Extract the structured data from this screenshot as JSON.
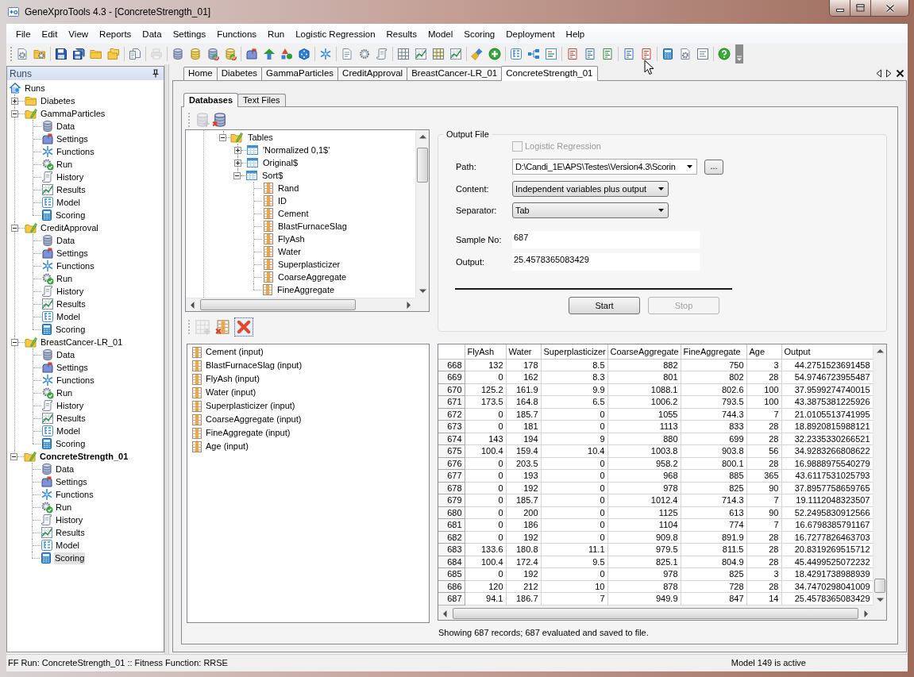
{
  "window": {
    "title": "GeneXproTools 4.3 - [ConcreteStrength_01]"
  },
  "menu": [
    "File",
    "Edit",
    "View",
    "Reports",
    "Data",
    "Settings",
    "Functions",
    "Run",
    "Logistic Regression",
    "Results",
    "Model",
    "Scoring",
    "Deployment",
    "Help"
  ],
  "toolbar": [
    [
      {
        "disabled": false
      },
      {
        "disabled": false
      }
    ],
    [
      {
        "disabled": false
      },
      {
        "disabled": false
      },
      {
        "disabled": false
      },
      {
        "disabled": false
      }
    ],
    [
      {
        "disabled": false
      }
    ],
    [
      {
        "disabled": true
      }
    ],
    [
      {
        "disabled": false
      },
      {
        "disabled": false
      },
      {
        "disabled": false
      },
      {
        "disabled": false
      }
    ],
    [
      {
        "disabled": false
      },
      {
        "disabled": false
      },
      {
        "disabled": false
      },
      {
        "disabled": false
      }
    ],
    [
      {
        "disabled": false
      }
    ],
    [
      {
        "disabled": false
      },
      {
        "disabled": false
      },
      {
        "disabled": false
      }
    ],
    [
      {
        "disabled": false
      },
      {
        "disabled": false
      },
      {
        "disabled": false
      },
      {
        "disabled": false
      }
    ],
    [
      {
        "disabled": false
      },
      {
        "disabled": false
      }
    ],
    [
      {
        "disabled": false
      },
      {
        "disabled": false
      },
      {
        "disabled": false
      }
    ],
    [
      {
        "disabled": false
      },
      {
        "disabled": false
      },
      {
        "disabled": false
      }
    ],
    [
      {
        "disabled": false
      },
      {
        "disabled": false
      }
    ],
    [
      {
        "disabled": false
      },
      {
        "disabled": false
      },
      {
        "disabled": false
      }
    ],
    [
      {
        "disabled": false
      }
    ]
  ],
  "sidebar": {
    "title": "Runs",
    "tree": [
      {
        "label": "Runs",
        "selected": false,
        "children": [
          {
            "label": "Diabetes",
            "expanded": false,
            "active": false,
            "selected": false
          },
          {
            "label": "GammaParticles",
            "expanded": true,
            "active": false,
            "selected": false,
            "children": [
              {
                "label": "Data",
                "kind": "data",
                "selected": false
              },
              {
                "label": "Settings",
                "kind": "settings",
                "selected": false
              },
              {
                "label": "Functions",
                "kind": "functions",
                "selected": false
              },
              {
                "label": "Run",
                "kind": "run",
                "selected": false
              },
              {
                "label": "History",
                "kind": "history",
                "selected": false
              },
              {
                "label": "Results",
                "kind": "results",
                "selected": false
              },
              {
                "label": "Model",
                "kind": "model",
                "selected": false
              },
              {
                "label": "Scoring",
                "kind": "scoring",
                "selected": false
              }
            ]
          },
          {
            "label": "CreditApproval",
            "expanded": true,
            "active": false,
            "selected": false,
            "children": [
              {
                "label": "Data",
                "kind": "data",
                "selected": false
              },
              {
                "label": "Settings",
                "kind": "settings",
                "selected": false
              },
              {
                "label": "Functions",
                "kind": "functions",
                "selected": false
              },
              {
                "label": "Run",
                "kind": "run",
                "selected": false
              },
              {
                "label": "History",
                "kind": "history",
                "selected": false
              },
              {
                "label": "Results",
                "kind": "results",
                "selected": false
              },
              {
                "label": "Model",
                "kind": "model",
                "selected": false
              },
              {
                "label": "Scoring",
                "kind": "scoring",
                "selected": false
              }
            ]
          },
          {
            "label": "BreastCancer-LR_01",
            "expanded": true,
            "active": false,
            "selected": false,
            "children": [
              {
                "label": "Data",
                "kind": "data",
                "selected": false
              },
              {
                "label": "Settings",
                "kind": "settings",
                "selected": false
              },
              {
                "label": "Functions",
                "kind": "functions",
                "selected": false
              },
              {
                "label": "Run",
                "kind": "run",
                "selected": false
              },
              {
                "label": "History",
                "kind": "history",
                "selected": false
              },
              {
                "label": "Results",
                "kind": "results",
                "selected": false
              },
              {
                "label": "Model",
                "kind": "model",
                "selected": false
              },
              {
                "label": "Scoring",
                "kind": "scoring",
                "selected": false
              }
            ]
          },
          {
            "label": "ConcreteStrength_01",
            "expanded": true,
            "active": true,
            "selected": false,
            "children": [
              {
                "label": "Data",
                "kind": "data",
                "selected": false
              },
              {
                "label": "Settings",
                "kind": "settings",
                "selected": false
              },
              {
                "label": "Functions",
                "kind": "functions",
                "selected": false
              },
              {
                "label": "Run",
                "kind": "run",
                "selected": false
              },
              {
                "label": "History",
                "kind": "history",
                "selected": false
              },
              {
                "label": "Results",
                "kind": "results",
                "selected": false
              },
              {
                "label": "Model",
                "kind": "model",
                "selected": false
              },
              {
                "label": "Scoring",
                "kind": "scoring",
                "selected": true
              }
            ]
          }
        ]
      }
    ]
  },
  "doc_tabs": [
    {
      "label": "Home",
      "selected": false
    },
    {
      "label": "Diabetes",
      "selected": false
    },
    {
      "label": "GammaParticles",
      "selected": false
    },
    {
      "label": "CreditApproval",
      "selected": false
    },
    {
      "label": "BreastCancer-LR_01",
      "selected": false
    },
    {
      "label": "ConcreteStrength_01",
      "selected": true
    }
  ],
  "database_tabs": [
    {
      "label": "Databases",
      "selected": true
    },
    {
      "label": "Text Files",
      "selected": false
    }
  ],
  "database_toolbar": [
    {
      "disabled": true
    },
    {
      "disabled": false
    }
  ],
  "table_tree": [
    {
      "label": "Tables",
      "expanded": true,
      "selected": false,
      "children": [
        {
          "label": "'Normalized 0,1$'",
          "expanded": false,
          "selected": false
        },
        {
          "label": "Original$",
          "expanded": false,
          "selected": false
        },
        {
          "label": "Sort$",
          "expanded": true,
          "selected": false,
          "children": [
            {
              "label": "Rand",
              "selected": false
            },
            {
              "label": "ID",
              "selected": false
            },
            {
              "label": "Cement",
              "selected": false
            },
            {
              "label": "BlastFurnaceSlag",
              "selected": false
            },
            {
              "label": "FlyAsh",
              "selected": false
            },
            {
              "label": "Water",
              "selected": false
            },
            {
              "label": "Superplasticizer",
              "selected": false
            },
            {
              "label": "CoarseAggregate",
              "selected": false
            },
            {
              "label": "FineAggregate",
              "selected": false
            }
          ]
        }
      ]
    }
  ],
  "field_toolbar": [
    {
      "disabled": true,
      "focused": false
    },
    {
      "disabled": false,
      "focused": false
    },
    {
      "disabled": false,
      "focused": true
    }
  ],
  "fields": [
    {
      "label": "Cement (input)",
      "selected": false
    },
    {
      "label": "BlastFurnaceSlag (input)",
      "selected": false
    },
    {
      "label": "FlyAsh (input)",
      "selected": false
    },
    {
      "label": "Water (input)",
      "selected": false
    },
    {
      "label": "Superplasticizer (input)",
      "selected": false
    },
    {
      "label": "CoarseAggregate (input)",
      "selected": false
    },
    {
      "label": "FineAggregate (input)",
      "selected": false
    },
    {
      "label": "Age (input)",
      "selected": false
    }
  ],
  "output_file": {
    "title": "Output File",
    "logistic_regression": {
      "label": "Logistic Regression",
      "checked": false,
      "disabled": true
    },
    "path": {
      "label": "Path:",
      "value": "D:\\Candi_1E\\APS\\Testes\\Version4.3\\Scorin"
    },
    "browse_button": {
      "label": "..."
    },
    "content": {
      "label": "Content:",
      "value": "Independent variables plus output"
    },
    "separator": {
      "label": "Separator:",
      "value": "Tab"
    },
    "sample_no": {
      "label": "Sample No:",
      "value": "687"
    },
    "output": {
      "label": "Output:",
      "value": "25.4578365083429"
    },
    "buttons": [
      {
        "label": "Start",
        "disabled": false
      },
      {
        "label": "Stop",
        "disabled": true
      }
    ]
  },
  "grid": {
    "columns": [
      "FlyAsh",
      "Water",
      "Superplasticizer",
      "CoarseAggregate",
      "FineAggregate",
      "Age",
      "Output"
    ],
    "rows": [
      {
        "header": "668",
        "cells": [
          "132",
          "178",
          "8.5",
          "882",
          "750",
          "3",
          "44.2751523691458"
        ]
      },
      {
        "header": "669",
        "cells": [
          "0",
          "162",
          "8.3",
          "801",
          "802",
          "28",
          "54.9746723955487"
        ]
      },
      {
        "header": "670",
        "cells": [
          "125.2",
          "161.9",
          "9.9",
          "1088.1",
          "802.6",
          "100",
          "37.9599274740015"
        ]
      },
      {
        "header": "671",
        "cells": [
          "173.5",
          "164.8",
          "6.5",
          "1006.2",
          "793.5",
          "100",
          "43.3875381225926"
        ]
      },
      {
        "header": "672",
        "cells": [
          "0",
          "185.7",
          "0",
          "1055",
          "744.3",
          "7",
          "21.0105513741995"
        ]
      },
      {
        "header": "673",
        "cells": [
          "0",
          "181",
          "0",
          "1113",
          "833",
          "28",
          "18.8920815988121"
        ]
      },
      {
        "header": "674",
        "cells": [
          "143",
          "194",
          "9",
          "880",
          "699",
          "28",
          "32.2335330266521"
        ]
      },
      {
        "header": "675",
        "cells": [
          "100.4",
          "159.4",
          "10.4",
          "1003.8",
          "903.8",
          "56",
          "34.9283266808622"
        ]
      },
      {
        "header": "676",
        "cells": [
          "0",
          "203.5",
          "0",
          "958.2",
          "800.1",
          "28",
          "16.9888975540279"
        ]
      },
      {
        "header": "677",
        "cells": [
          "0",
          "193",
          "0",
          "968",
          "885",
          "365",
          "43.6117531025793"
        ]
      },
      {
        "header": "678",
        "cells": [
          "0",
          "192",
          "0",
          "978",
          "825",
          "90",
          "37.8957758659765"
        ]
      },
      {
        "header": "679",
        "cells": [
          "0",
          "185.7",
          "0",
          "1012.4",
          "714.3",
          "7",
          "19.1112048323507"
        ]
      },
      {
        "header": "680",
        "cells": [
          "0",
          "200",
          "0",
          "1125",
          "613",
          "90",
          "52.2495830912566"
        ]
      },
      {
        "header": "681",
        "cells": [
          "0",
          "186",
          "0",
          "1104",
          "774",
          "7",
          "16.6798385791167"
        ]
      },
      {
        "header": "682",
        "cells": [
          "0",
          "192",
          "0",
          "909.8",
          "891.9",
          "28",
          "16.7277826463703"
        ]
      },
      {
        "header": "683",
        "cells": [
          "133.6",
          "180.8",
          "11.1",
          "979.5",
          "811.5",
          "28",
          "20.8319269515712"
        ]
      },
      {
        "header": "684",
        "cells": [
          "100.4",
          "172.4",
          "9.5",
          "825.1",
          "804.9",
          "28",
          "45.4499525072232"
        ]
      },
      {
        "header": "685",
        "cells": [
          "0",
          "192",
          "0",
          "978",
          "825",
          "3",
          "18.4291738988939"
        ]
      },
      {
        "header": "686",
        "cells": [
          "120",
          "212",
          "10",
          "878",
          "728",
          "28",
          "34.7470298041009"
        ]
      },
      {
        "header": "687",
        "cells": [
          "94.1",
          "186.7",
          "7",
          "949.9",
          "847",
          "14",
          "25.4578365083429"
        ]
      }
    ]
  },
  "grid_status": "Showing 687 records; 687 evaluated and saved to file.",
  "status_bar": {
    "left": "FF Run: ConcreteStrength_01 :: Fitness Function: RRSE",
    "right": "Model 149 is active"
  }
}
